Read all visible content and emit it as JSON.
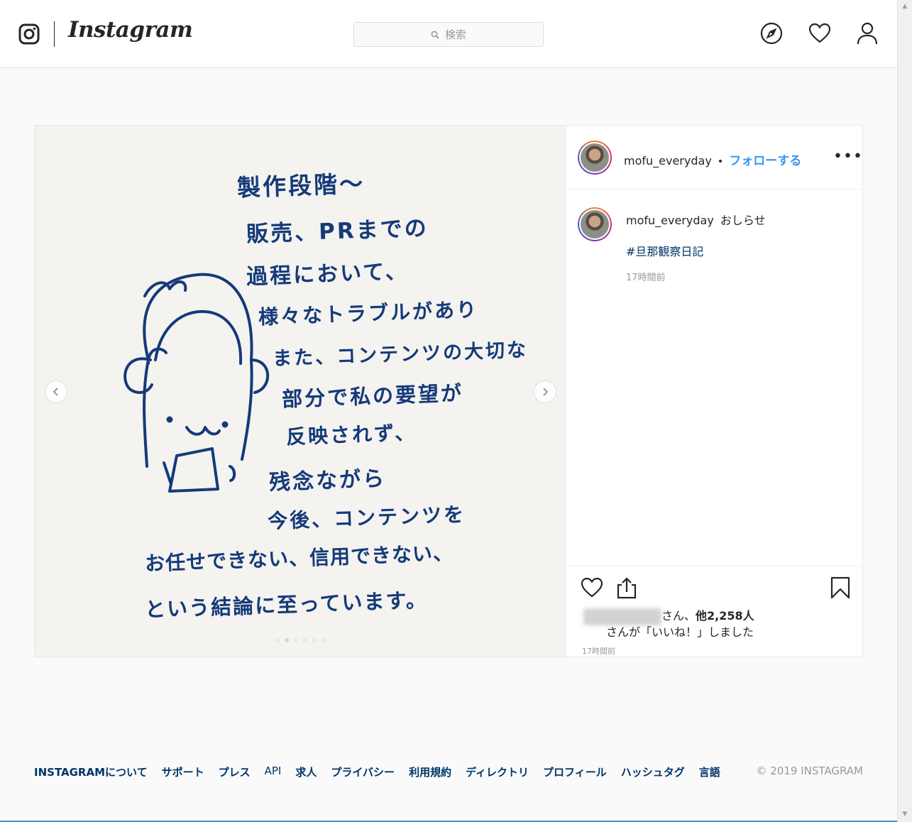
{
  "header": {
    "brand": "Instagram",
    "search_placeholder": "検索",
    "icons": [
      "instagram-logo-icon",
      "compass-icon",
      "heart-icon",
      "person-icon"
    ]
  },
  "post": {
    "image_text_lines": [
      "製作段階〜",
      "販売、PRまでの",
      "過程において、",
      "様々なトラブルがあり",
      "また、コンテンツの大切な",
      "部分で私の要望が",
      "反映されず、",
      "残念ながら",
      "今後、コンテンツを",
      "お任せできない、信用できない、",
      "という結論に至っています。"
    ],
    "carousel": {
      "slide_count": 6,
      "active_index": 1
    },
    "author": {
      "username": "mofu_everyday",
      "separator": "•",
      "follow_label": "フォローする",
      "more_label": "•••"
    },
    "caption": {
      "username": "mofu_everyday",
      "text": "おしらせ",
      "hashtag": "#旦那観察日記",
      "time": "17時間前"
    },
    "likes": {
      "suffix": "さん、",
      "others": "他2,258人",
      "line2": "さんが「いいね！」しました",
      "time": "17時間前"
    }
  },
  "footer": {
    "links": [
      "INSTAGRAMについて",
      "サポート",
      "プレス",
      "API",
      "求人",
      "プライバシー",
      "利用規約",
      "ディレクトリ",
      "プロフィール",
      "ハッシュタグ",
      "言語"
    ],
    "copyright": "© 2019 INSTAGRAM"
  },
  "colors": {
    "link_blue": "#3897f0",
    "footer_link": "#003569",
    "ink": "#153a7a"
  }
}
